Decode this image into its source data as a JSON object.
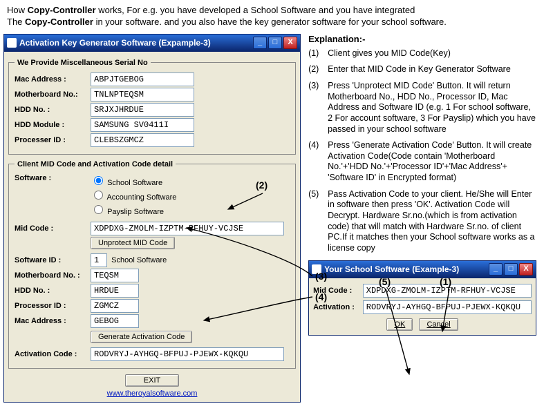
{
  "intro": {
    "line1_a": "How ",
    "bold1": "Copy-Controller",
    "line1_b": " works, For e.g. you have developed a School Software and you have integrated",
    "line2_a": "The ",
    "bold2": "Copy-Controller",
    "line2_b": "  in your software. and you also have the key generator software for your school software."
  },
  "genwin": {
    "title": "Activation Key Generator Software (Expample-3)",
    "group_serial": "We Provide Miscellaneous Serial No",
    "fields": {
      "mac_label": "Mac Address :",
      "mac_value": "ABPJTGEBOG",
      "mobo_label": "Motherboard No.:",
      "mobo_value": "TNLNPTEQSM",
      "hdd_label": "HDD No. :",
      "hdd_value": "SRJXJHRDUE",
      "hddmod_label": "HDD Module :",
      "hddmod_value": "SAMSUNG SV0411I",
      "proc_label": "Processer ID :",
      "proc_value": "CLEBSZGMCZ"
    },
    "group_client": "Client MID Code and Activation Code detail",
    "sw_label": "Software :",
    "radios": {
      "opt1": "School Software",
      "opt2": "Accounting Software",
      "opt3": "Payslip Software"
    },
    "mid_label": "Mid Code :",
    "mid_value": "XDPDXG-ZMOLM-IZPTM-RFHUY-VCJSE",
    "btn_unprotect": "Unprotect MID Code",
    "swid_label": "Software ID :",
    "swid_value": "1",
    "swid_name": "School Software",
    "mobo2_label": "Motherboard No. :",
    "mobo2_value": "TEQSM",
    "hdd2_label": "HDD No. :",
    "hdd2_value": "HRDUE",
    "proc2_label": "Processor ID :",
    "proc2_value": "ZGMCZ",
    "mac2_label": "Mac Address :",
    "mac2_value": "GEBOG",
    "btn_generate": "Generate Activation Code",
    "act_label": "Activation Code :",
    "act_value": "RODVRYJ-AYHGQ-BFPUJ-PJEWX-KQKQU",
    "btn_exit": "EXIT",
    "link": "www.theroyalsoftware.com"
  },
  "explanation": {
    "heading": "Explanation:-",
    "items": [
      {
        "n": "(1)",
        "t": "Client gives you MID Code(Key)"
      },
      {
        "n": "(2)",
        "t": "Enter that MID Code in Key Generator Software"
      },
      {
        "n": "(3)",
        "t": "Press 'Unprotect MID Code' Button. It will return Motherboard No., HDD No., Processor ID, Mac Address and Software ID (e.g. 1 For school software, 2 For account software, 3 For Payslip) which you have passed in your school software"
      },
      {
        "n": "(4)",
        "t": "Press 'Generate Activation Code' Button. It will create Activation Code(Code contain 'Motherboard No.'+'HDD No.'+'Processor ID'+'Mac Address'+ 'Software ID' in Encrypted format)"
      },
      {
        "n": "(5)",
        "t": "Pass Activation Code to your client. He/She will Enter in software then press 'OK'. Activation Code will Decrypt. Hardware Sr.no.(which is from activation code) that will match with Hardware Sr.no. of client PC.If it matches then your School software works as a license copy"
      }
    ]
  },
  "schoolwin": {
    "title": "Your School Software (Example-3)",
    "mid_label": "Mid Code :",
    "mid_value": "XDPDXG-ZMOLM-IZPTM-RFHUY-VCJSE",
    "act_label": "Activation :",
    "act_value": "RODVRYJ-AYHGQ-BFPUJ-PJEWX-KQKQU",
    "btn_ok": "OK",
    "btn_cancel": "Cancel"
  },
  "annotations": {
    "a1": "(1)",
    "a2": "(2)",
    "a3": "(3)",
    "a4": "(4)",
    "a5": "(5)"
  }
}
